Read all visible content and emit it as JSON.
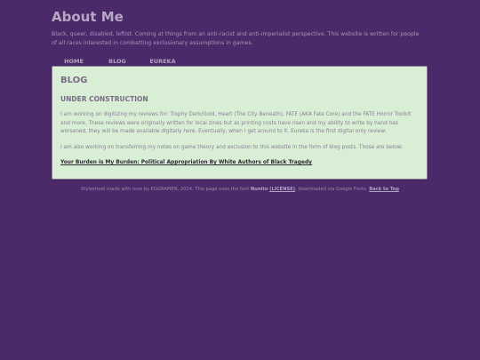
{
  "header": {
    "title": "About Me",
    "tagline": "Black, queer, disabled, leftist. Coming at things from an anti-racist and anti-imperialist perspective. This website is written for people of all races interested in combatting exclusionary assumptions in games."
  },
  "nav": {
    "items": [
      {
        "label": "HOME"
      },
      {
        "label": "BLOG"
      },
      {
        "label": "EUREKA"
      }
    ]
  },
  "main": {
    "heading": "BLOG",
    "subheading": "UNDER CONSTRUCTION",
    "paragraph_1": "I am working on digitizing my reviews for: Trophy Dark/Gold, Heart (The City Beneath), FATE (AKA Fate Core) and the FATE Horror Toolkit and more. These reviews were originally written for local zines but as printing costs have risen and my ability to write by hand has worsened, they will be made available digitally here. Eventually, when I get around to it. Eureka is the first digital only review.",
    "paragraph_2": "I am also working on transferring my notes on game theory and exclusion to this website in the form of blog posts. Those are below:",
    "post_link": "Your Burden is My Burden: Political Appropriation By White Authors of Black Tragedy"
  },
  "footer": {
    "text_1": "Stylesheet made with love by EGGRAMEN, 2024. This page uses the font",
    "font_name": "Nunito",
    "license_link": "(LICENSE)",
    "text_2": ", downloaded via Google Fonts.",
    "back_to_top": "Back to Top"
  },
  "colors": {
    "background": "#4a2a68",
    "panel": "#d8efd6",
    "text_muted": "#b3a3c3"
  }
}
